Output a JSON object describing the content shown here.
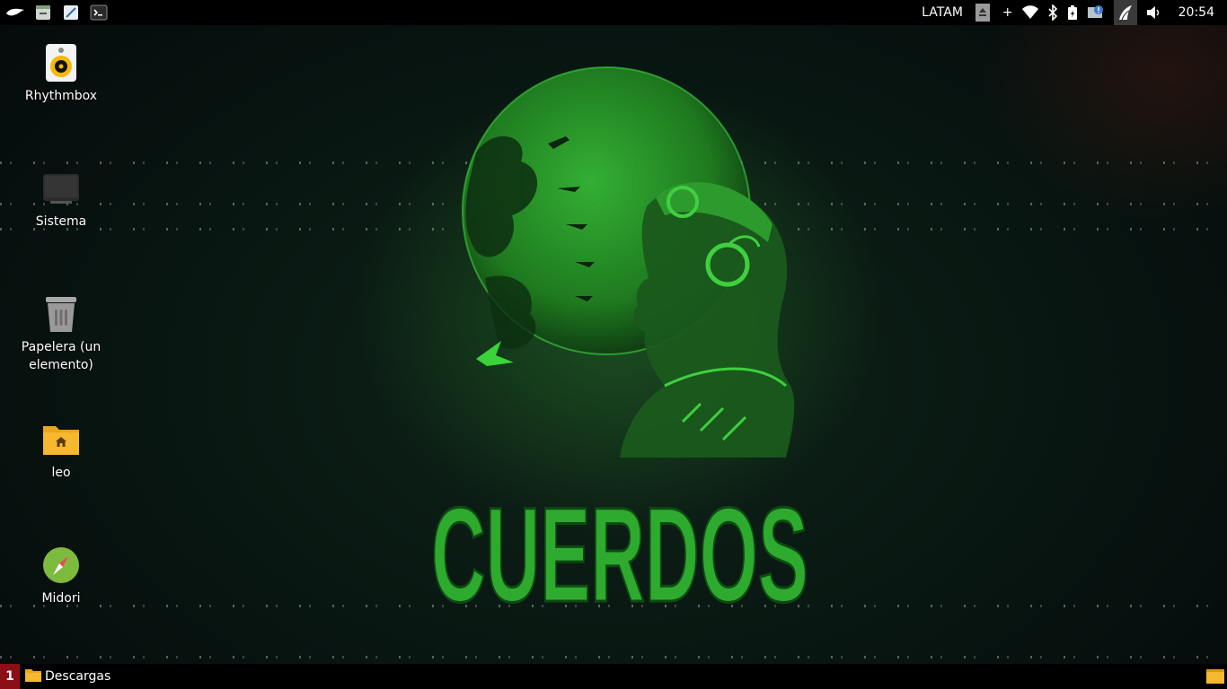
{
  "top_panel": {
    "launchers": [
      {
        "name": "app-menu-icon"
      },
      {
        "name": "file-manager-icon"
      },
      {
        "name": "text-editor-icon"
      },
      {
        "name": "terminal-icon"
      }
    ],
    "keyboard_layout": "LATAM",
    "add_label": "+",
    "clock": "20:54"
  },
  "desktop": {
    "icons": [
      {
        "label": "Rhythmbox",
        "icon": "rhythmbox-icon"
      },
      {
        "label": "Sistema",
        "icon": "computer-icon"
      },
      {
        "label": "Papelera (un elemento)",
        "icon": "trash-icon"
      },
      {
        "label": "leo",
        "icon": "home-folder-icon"
      },
      {
        "label": "Midori",
        "icon": "midori-icon"
      }
    ],
    "wallpaper_text": "CUERDOS"
  },
  "bottom_panel": {
    "workspace": "1",
    "tasks": [
      {
        "label": "Descargas",
        "icon": "folder-icon"
      }
    ]
  },
  "colors": {
    "panel_bg": "#000000",
    "workspace_active": "#8b0f14",
    "wallpaper_green": "#2fae2f",
    "folder_yellow": "#f5b82e"
  }
}
